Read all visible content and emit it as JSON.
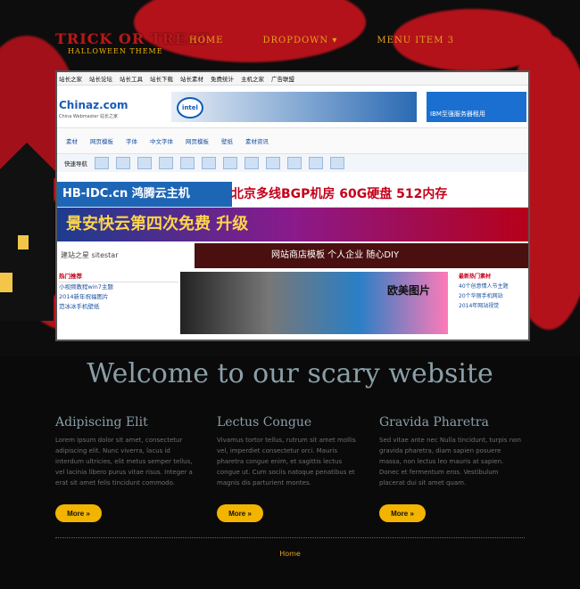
{
  "site": {
    "logo_title": "TRICK OR TREAT",
    "logo_subtitle": "HALLOWEEN THEME"
  },
  "nav": {
    "items": [
      "HOME",
      "DROPDOWN",
      "MENU ITEM 3"
    ]
  },
  "screenshot": {
    "topbar": [
      "站长之家",
      "站长论坛",
      "站长工具",
      "站长下载",
      "站长素材",
      "免费统计",
      "主机之家",
      "广告联盟"
    ],
    "logo": "Chinaz.com",
    "logo_sub": "China Webmaster 站长之家",
    "intel_label": "intel",
    "ibm_text": "IBM至强服务器租用",
    "links": [
      "素材",
      "网页模板",
      "字体",
      "中文字体",
      "网页模板",
      "壁纸",
      "素材资讯"
    ],
    "quick_label": "快速导航",
    "ad1_left": "HB-IDC.cn 鸿腾云主机",
    "ad1_right": "北京多线BGP机房 60G硬盘 512内存",
    "ad2": "景安快云第四次免费 升级",
    "ad3_left": "建站之星 sitestar",
    "ad3_right": "网站商店模板 个人企业 随心DIY",
    "hot_title": "热门推荐",
    "hot_items": [
      "小视频教程win7主题",
      "2014新年祝福图片",
      "范冰冰手机壁纸"
    ],
    "photo_title": "欧美图片",
    "latest_title": "最新热门素材",
    "latest_items": [
      "40个创意情人节主题",
      "20个华丽手机网站",
      "2014年网站视觉"
    ]
  },
  "welcome": "Welcome to our scary website",
  "columns": [
    {
      "title": "Adipiscing Elit",
      "text": "Lorem ipsum dolor sit amet, consectetur adipiscing elit. Nunc viverra, lacus id interdum ultricies, elit metus semper tellus, vel lacinia libero purus vitae risus. Integer a erat sit amet felis tincidunt commodo.",
      "more": "More"
    },
    {
      "title": "Lectus Congue",
      "text": "Vivamus tortor tellus, rutrum sit amet mollis vel, imperdiet consectetur orci. Mauris pharetra congue enim, et sagittis lectus congue ut. Cum sociis natoque penatibus et magnis dis parturient montes.",
      "more": "More"
    },
    {
      "title": "Gravida Pharetra",
      "text": "Sed vitae ante nec Nulla tincidunt, turpis non gravida pharetra, diam sapien posuere massa, non lectus leo mauris at sapien. Donec et fermentum eros. Vestibulum placerat dui sit amet quam.",
      "more": "More"
    }
  ],
  "footer": {
    "home": "Home"
  },
  "colors": {
    "accent": "#f3b400",
    "heading": "#8a9fa9",
    "blood": "#b3121b"
  }
}
